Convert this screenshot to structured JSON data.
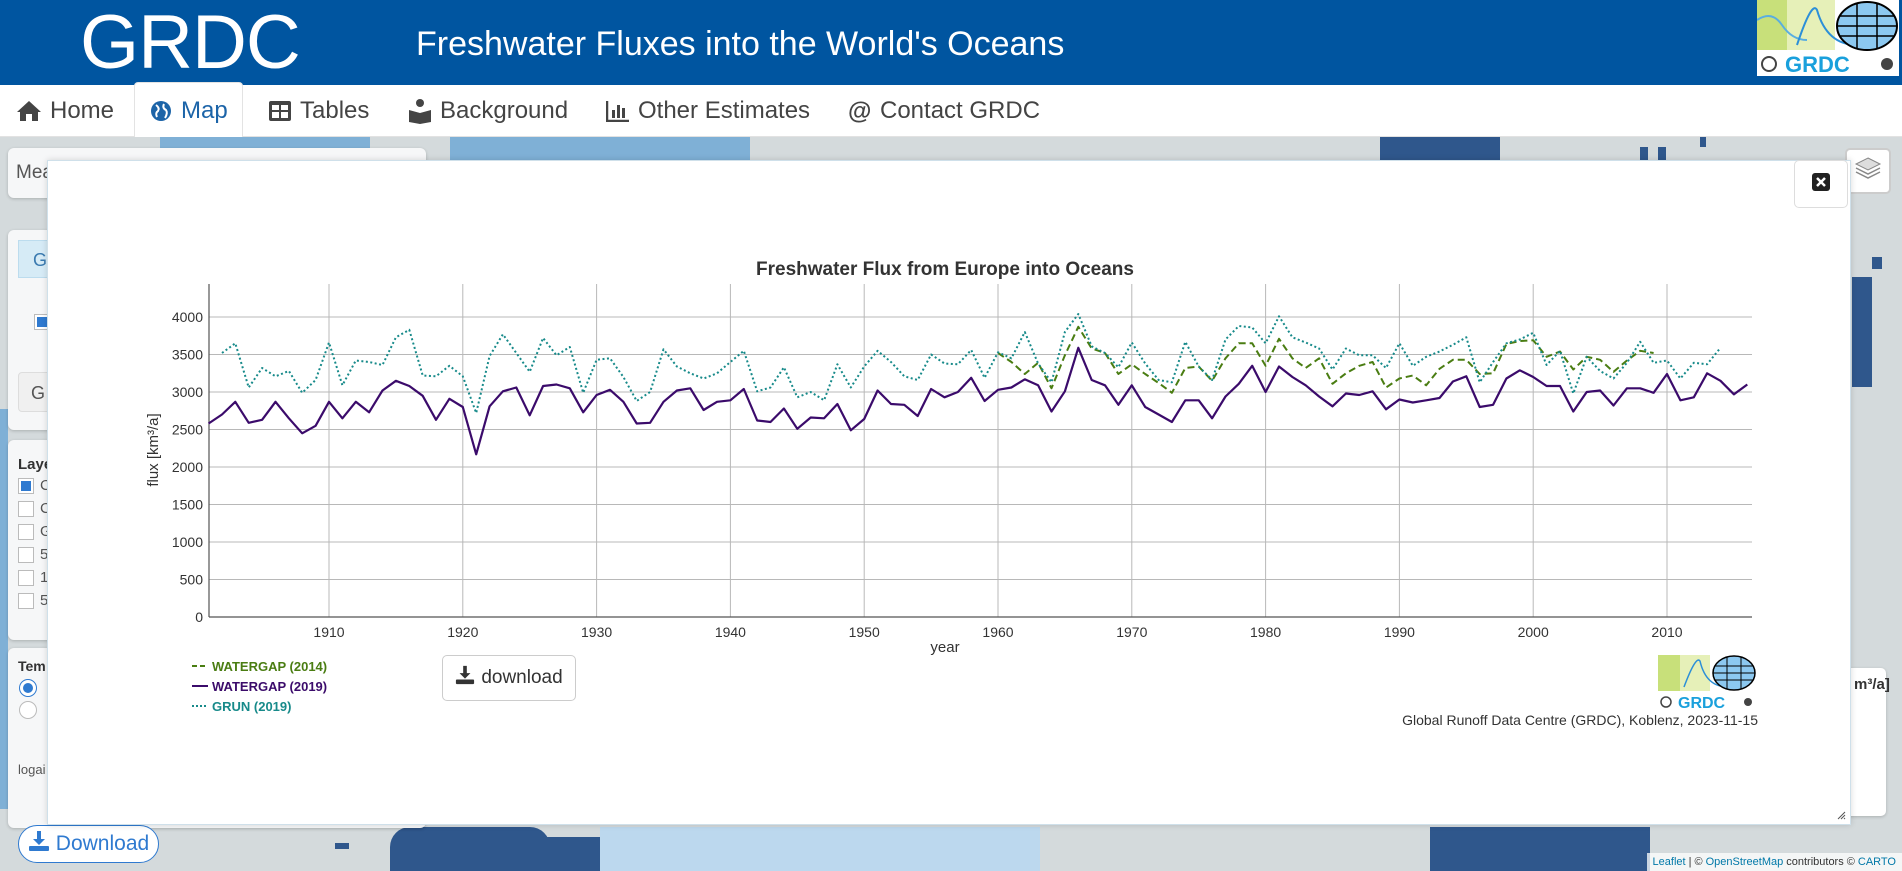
{
  "header": {
    "brand": "GRDC",
    "title": "Freshwater Fluxes into the World's Oceans",
    "logo_text": "GRDC"
  },
  "nav": {
    "items": [
      {
        "label": "Home",
        "icon": "home-icon",
        "active": false
      },
      {
        "label": "Map",
        "icon": "globe-icon",
        "active": true
      },
      {
        "label": "Tables",
        "icon": "table-icon",
        "active": false
      },
      {
        "label": "Background",
        "icon": "reader-icon",
        "active": false
      },
      {
        "label": "Other Estimates",
        "icon": "bar-chart-icon",
        "active": false
      },
      {
        "label": "Contact GRDC",
        "icon": "at-icon",
        "active": false
      }
    ]
  },
  "left_panel": {
    "search_partial": "Mea",
    "tab_partial": "G",
    "button_partial": "G",
    "layers_heading": "Laye",
    "layers": [
      {
        "label": "C",
        "checked": true
      },
      {
        "label": "C",
        "checked": false
      },
      {
        "label": "G",
        "checked": false
      },
      {
        "label": "5",
        "checked": false
      },
      {
        "label": "1",
        "checked": false
      },
      {
        "label": "5",
        "checked": false
      }
    ],
    "temporal_heading": "Tem",
    "radios": [
      {
        "checked": true
      },
      {
        "checked": false
      }
    ],
    "log_label": "logai",
    "download_label": "Download"
  },
  "right_box": {
    "title_partial": "m³/a]"
  },
  "map_attribution": {
    "leaflet": "Leaflet",
    "sep": "| ©",
    "osm": "OpenStreetMap",
    "contributors": "contributors ©",
    "carto": "CARTO"
  },
  "modal": {
    "download_label": "download",
    "credit": "Global Runoff Data Centre (GRDC), Koblenz, 2023-11-15",
    "logo_text": "GRDC"
  },
  "colors": {
    "header_bg": "#0055a0",
    "watergap2014": "#4a7d12",
    "watergap2019": "#3b0b6b",
    "grun": "#178a8a",
    "accent": "#2f7ad0"
  },
  "chart_data": {
    "type": "line",
    "title": "Freshwater Flux from Europe into Oceans",
    "xlabel": "year",
    "ylabel": "flux [km³/a]",
    "xlim": [
      1901,
      2016
    ],
    "ylim": [
      0,
      4400
    ],
    "xticks": [
      1910,
      1920,
      1930,
      1940,
      1950,
      1960,
      1970,
      1980,
      1990,
      2000,
      2010
    ],
    "yticks": [
      0,
      500,
      1000,
      1500,
      2000,
      2500,
      3000,
      3500,
      4000
    ],
    "grid": true,
    "legend_position": "bottom-left",
    "series": [
      {
        "name": "WATERGAP (2014)",
        "style": "dashed",
        "start_year": 1960,
        "values": [
          3520,
          3400,
          3240,
          3390,
          3050,
          3490,
          3870,
          3580,
          3520,
          3240,
          3370,
          3240,
          3120,
          2990,
          3320,
          3340,
          3150,
          3450,
          3650,
          3650,
          3350,
          3710,
          3450,
          3320,
          3450,
          3110,
          3250,
          3350,
          3400,
          3060,
          3180,
          3220,
          3090,
          3310,
          3430,
          3430,
          3240,
          3250,
          3640,
          3680,
          3690,
          3470,
          3540,
          3300,
          3470,
          3430,
          3270,
          3420,
          3550,
          3520
        ]
      },
      {
        "name": "WATERGAP (2019)",
        "style": "solid",
        "start_year": 1901,
        "values": [
          2580,
          2700,
          2870,
          2590,
          2630,
          2870,
          2650,
          2450,
          2550,
          2870,
          2650,
          2870,
          2730,
          3020,
          3150,
          3080,
          2950,
          2630,
          2910,
          2800,
          2170,
          2810,
          3010,
          3060,
          2690,
          3080,
          3100,
          3050,
          2730,
          2960,
          3030,
          2870,
          2580,
          2590,
          2870,
          3020,
          3050,
          2760,
          2870,
          2890,
          3040,
          2620,
          2600,
          2780,
          2510,
          2660,
          2650,
          2840,
          2490,
          2640,
          3020,
          2840,
          2830,
          2680,
          3040,
          2930,
          3000,
          3190,
          2880,
          3030,
          3060,
          3170,
          3090,
          2740,
          3010,
          3590,
          3160,
          3090,
          2830,
          3090,
          2800,
          2700,
          2600,
          2890,
          2890,
          2650,
          2940,
          3110,
          3350,
          3000,
          3340,
          3200,
          3090,
          2940,
          2810,
          2980,
          2960,
          3010,
          2770,
          2900,
          2860,
          2890,
          2920,
          3140,
          3210,
          2800,
          2830,
          3180,
          3290,
          3200,
          3080,
          3080,
          2740,
          3000,
          3020,
          2820,
          3050,
          3050,
          2990,
          3240,
          2890,
          2930,
          3250,
          3150,
          2970,
          3100
        ]
      },
      {
        "name": "GRUN (2019)",
        "style": "dotted",
        "start_year": 1902,
        "values": [
          3520,
          3650,
          3060,
          3320,
          3210,
          3280,
          2990,
          3160,
          3660,
          3090,
          3420,
          3400,
          3360,
          3730,
          3830,
          3220,
          3210,
          3350,
          3210,
          2720,
          3480,
          3770,
          3520,
          3270,
          3720,
          3490,
          3600,
          2990,
          3430,
          3450,
          3200,
          2880,
          3000,
          3570,
          3340,
          3250,
          3180,
          3250,
          3400,
          3550,
          3010,
          3060,
          3330,
          2930,
          3000,
          2890,
          3370,
          3060,
          3340,
          3550,
          3400,
          3210,
          3160,
          3500,
          3380,
          3370,
          3560,
          3190,
          3530,
          3450,
          3800,
          3380,
          3130,
          3800,
          4040,
          3610,
          3520,
          3330,
          3660,
          3380,
          3160,
          3130,
          3670,
          3340,
          3160,
          3700,
          3880,
          3860,
          3650,
          4010,
          3730,
          3660,
          3580,
          3300,
          3580,
          3490,
          3490,
          3320,
          3650,
          3350,
          3470,
          3540,
          3630,
          3730,
          3130,
          3400,
          3650,
          3700,
          3790,
          3360,
          3550,
          2980,
          3470,
          3280,
          3180,
          3390,
          3670,
          3390,
          3420,
          3180,
          3390,
          3370,
          3590
        ]
      }
    ]
  }
}
